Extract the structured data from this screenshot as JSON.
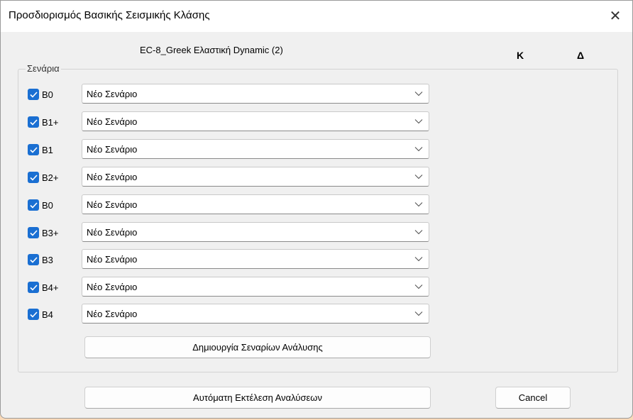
{
  "window": {
    "title": "Προσδιορισμός Βασικής Σεισμικής Κλάσης"
  },
  "header": {
    "subtitle": "EC-8_Greek Ελαστική Dynamic (2)",
    "col_k": "K",
    "col_d": "Δ"
  },
  "group": {
    "legend": "Σενάρια"
  },
  "scenarios": [
    {
      "label": "B0",
      "checked": true,
      "value": "Νέο Σενάριο"
    },
    {
      "label": "B1+",
      "checked": true,
      "value": "Νέο Σενάριο"
    },
    {
      "label": "B1",
      "checked": true,
      "value": "Νέο Σενάριο"
    },
    {
      "label": "B2+",
      "checked": true,
      "value": "Νέο Σενάριο"
    },
    {
      "label": "B0",
      "checked": true,
      "value": "Νέο Σενάριο"
    },
    {
      "label": "B3+",
      "checked": true,
      "value": "Νέο Σενάριο"
    },
    {
      "label": "B3",
      "checked": true,
      "value": "Νέο Σενάριο"
    },
    {
      "label": "B4+",
      "checked": true,
      "value": "Νέο Σενάριο"
    },
    {
      "label": "B4",
      "checked": true,
      "value": "Νέο Σενάριο"
    }
  ],
  "buttons": {
    "create": "Δημιουργία Σεναρίων Ανάλυσης",
    "auto_run": "Αυτόματη Εκτέλεση Αναλύσεων",
    "cancel": "Cancel"
  },
  "colors": {
    "accent": "#1a6fd2",
    "dialog_bg": "#f0f0f0"
  }
}
